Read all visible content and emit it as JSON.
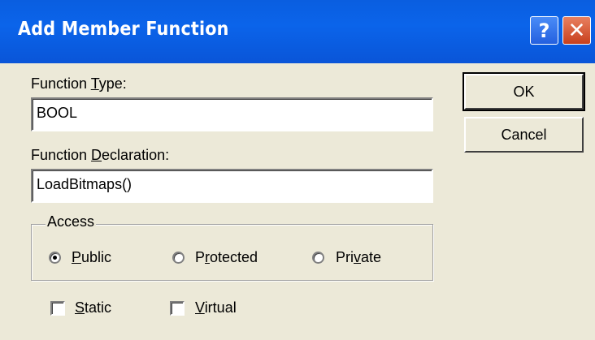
{
  "dialog": {
    "title": "Add Member Function",
    "help_glyph": "?",
    "close_glyph": "✕"
  },
  "function_type": {
    "label_pre": "Function ",
    "label_key": "T",
    "label_post": "ype:",
    "value": "BOOL"
  },
  "function_declaration": {
    "label_pre": "Function ",
    "label_key": "D",
    "label_post": "eclaration:",
    "value": "LoadBitmaps()"
  },
  "buttons": {
    "ok": "OK",
    "cancel": "Cancel"
  },
  "access": {
    "caption": "Access",
    "options": [
      {
        "key": "P",
        "rest": "ublic",
        "selected": true
      },
      {
        "pre": "P",
        "key": "r",
        "rest": "otected",
        "selected": false
      },
      {
        "pre": "Pri",
        "key": "v",
        "rest": "ate",
        "selected": false
      }
    ]
  },
  "modifiers": {
    "static": {
      "key": "S",
      "rest": "tatic",
      "checked": false
    },
    "virtual": {
      "key": "V",
      "rest": "irtual",
      "checked": false
    }
  }
}
